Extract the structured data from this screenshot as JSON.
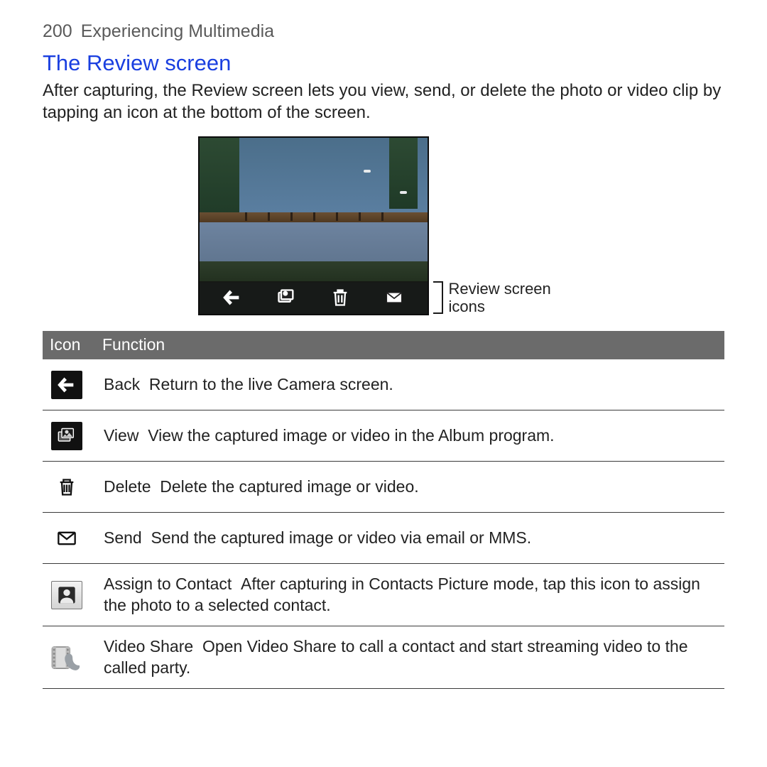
{
  "header": {
    "page_number": "200",
    "chapter": "Experiencing Multimedia"
  },
  "section": {
    "title": "The Review screen",
    "body": "After capturing, the Review screen lets you view, send, or delete the photo or video clip by tapping an icon at the bottom of the screen."
  },
  "figure": {
    "callout": "Review screen icons",
    "bar_icons": [
      "back-icon",
      "view-icon",
      "delete-icon",
      "send-icon"
    ]
  },
  "table": {
    "headers": {
      "icon": "Icon",
      "function": "Function"
    },
    "rows": [
      {
        "icon": "back-icon",
        "name": "Back",
        "desc": "Return to the live Camera screen."
      },
      {
        "icon": "view-icon",
        "name": "View",
        "desc": "View the captured image or video in the Album program."
      },
      {
        "icon": "delete-icon",
        "name": "Delete",
        "desc": "Delete the captured image or video."
      },
      {
        "icon": "send-icon",
        "name": "Send",
        "desc": "Send the captured image or video via email or MMS."
      },
      {
        "icon": "assign-contact-icon",
        "name": "Assign to Contact",
        "desc": "After capturing in Contacts Picture mode, tap this icon to assign the photo to a selected contact."
      },
      {
        "icon": "video-share-icon",
        "name": "Video Share",
        "desc": "Open Video Share to call a contact and start streaming video to the called party."
      }
    ]
  }
}
